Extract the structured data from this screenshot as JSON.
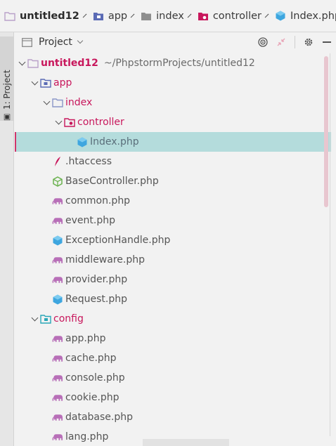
{
  "breadcrumb": {
    "items": [
      {
        "label": "untitled12",
        "icon": "project-folder-icon"
      },
      {
        "label": "app",
        "icon": "module-folder-icon"
      },
      {
        "label": "index",
        "icon": "folder-icon"
      },
      {
        "label": "controller",
        "icon": "namespace-folder-icon"
      },
      {
        "label": "Index.php",
        "icon": "php-class-icon"
      }
    ]
  },
  "side_strip": {
    "label": "1: Project"
  },
  "panel": {
    "title": "Project",
    "tools": [
      "locate-icon",
      "collapse-icon",
      "settings-icon",
      "hide-icon"
    ]
  },
  "tree": {
    "root": {
      "label": "untitled12",
      "path": "~/PhpstormProjects/untitled12"
    },
    "rows": [
      {
        "label": "app",
        "kind": "module-dir"
      },
      {
        "label": "index",
        "kind": "dir"
      },
      {
        "label": "controller",
        "kind": "namespace-dir"
      },
      {
        "label": "Index.php",
        "kind": "php-class"
      },
      {
        "label": ".htaccess",
        "kind": "htaccess"
      },
      {
        "label": "BaseController.php",
        "kind": "php-abstract"
      },
      {
        "label": "common.php",
        "kind": "php"
      },
      {
        "label": "event.php",
        "kind": "php"
      },
      {
        "label": "ExceptionHandle.php",
        "kind": "php-class"
      },
      {
        "label": "middleware.php",
        "kind": "php"
      },
      {
        "label": "provider.php",
        "kind": "php"
      },
      {
        "label": "Request.php",
        "kind": "php-class"
      },
      {
        "label": "config",
        "kind": "config-dir"
      },
      {
        "label": "app.php",
        "kind": "php"
      },
      {
        "label": "cache.php",
        "kind": "php"
      },
      {
        "label": "console.php",
        "kind": "php"
      },
      {
        "label": "cookie.php",
        "kind": "php"
      },
      {
        "label": "database.php",
        "kind": "php"
      },
      {
        "label": "lang.php",
        "kind": "php"
      }
    ]
  },
  "colors": {
    "selection": "#b4dcdc",
    "directory_text": "#c8175c",
    "php_icon": "#b86fb8",
    "class_icon": "#3ea6df"
  }
}
